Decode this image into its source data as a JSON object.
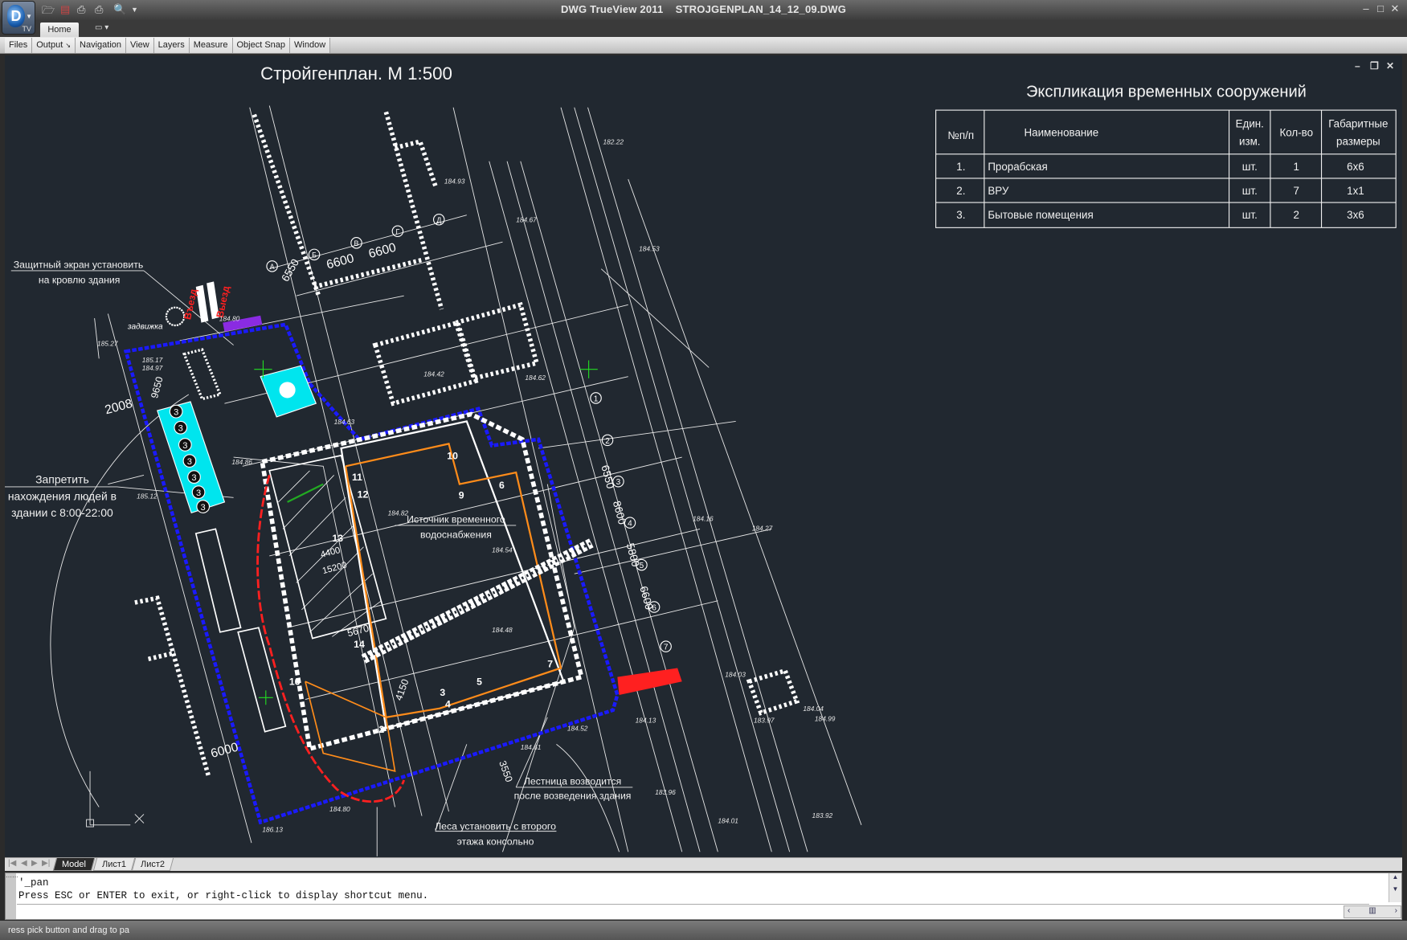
{
  "titlebar": {
    "app_name": "DWG TrueView 2011",
    "file_name": "STROJGENPLAN_14_12_09.DWG",
    "app_badge": "TV",
    "icons": [
      "open-icon",
      "export-icon",
      "print-icon",
      "batch-plot-icon",
      "preview-icon",
      "qat-dropdown-icon"
    ]
  },
  "ribbon": {
    "tabs": [
      {
        "label": "Home"
      }
    ],
    "panels": [
      "Files",
      "Output",
      "Navigation",
      "View",
      "Layers",
      "Measure",
      "Object Snap",
      "Window"
    ],
    "output_launcher": "↘"
  },
  "drawing": {
    "title": "Стройгенплан. М 1:500",
    "background": "#212830",
    "boundary_color": "#1a1aff",
    "scaffold_color": "#ff8c1a",
    "temp_color": "#00e5ee",
    "path_color": "#ff2020",
    "annotations": {
      "screen_1": "Защитный экран установить",
      "screen_2": "на кровлю здания",
      "forbid_1": "Запретить",
      "forbid_2": "нахождения людей в",
      "forbid_3": "здании с 8:00-22:00",
      "water_1": "Источник временного",
      "water_2": "водоснабжения",
      "stair_1": "Лестница возводится",
      "stair_2": "после возведения здания",
      "scaf_1": "Леса установить с второго",
      "scaf_2": "этажа консольно",
      "entry": "Въезд",
      "exit": "Выезд",
      "valve": "задвижка"
    },
    "dim_labels": [
      "6600",
      "6600",
      "6550",
      "2008",
      "6000",
      "5670",
      "4400",
      "15200",
      "6550",
      "8600",
      "5800",
      "6600",
      "4150",
      "3550",
      "9650"
    ],
    "elev_labels": [
      "184.80",
      "184.93",
      "185.27",
      "185.17",
      "184.97",
      "185.12",
      "184.63",
      "184.82",
      "184.54",
      "184.53",
      "184.04",
      "183.97",
      "184.13",
      "184.52",
      "184.61",
      "184.80",
      "186.13",
      "183.96",
      "184.03",
      "184.62",
      "184.67",
      "184.16",
      "184.27",
      "182.22",
      "184.99",
      "184.48",
      "184.42",
      "184.86",
      "183.92",
      "184.01"
    ],
    "axis_numbers": [
      "1",
      "2",
      "3",
      "4",
      "5",
      "6",
      "7"
    ],
    "axis_letters": [
      "А",
      "Б",
      "В",
      "Г",
      "Д"
    ],
    "building_marks": [
      "10",
      "11",
      "12",
      "13",
      "14",
      "16",
      "2",
      "3",
      "4",
      "5",
      "6",
      "7",
      "9"
    ],
    "temp_building_mark": "3"
  },
  "explication": {
    "title": "Экспликация временных сооружений",
    "headers": {
      "num": "№п/п",
      "name": "Наименование",
      "unit_1": "Един.",
      "unit_2": "изм.",
      "qty": "Кол-во",
      "size_1": "Габаритные",
      "size_2": "размеры"
    },
    "rows": [
      {
        "num": "1.",
        "name": "Прорабская",
        "unit": "шт.",
        "qty": "1",
        "size": "6x6"
      },
      {
        "num": "2.",
        "name": "ВРУ",
        "unit": "шт.",
        "qty": "7",
        "size": "1x1"
      },
      {
        "num": "3.",
        "name": "Бытовые помещения",
        "unit": "шт.",
        "qty": "2",
        "size": "3x6"
      }
    ]
  },
  "layout_tabs": [
    "Model",
    "Лист1",
    "Лист2"
  ],
  "active_layout": "Model",
  "command": {
    "history_1": "'_pan",
    "history_2": "Press ESC or ENTER to exit, or right-click to display shortcut menu.",
    "input": ""
  },
  "status": {
    "text": "ress pick button and drag to pa"
  }
}
